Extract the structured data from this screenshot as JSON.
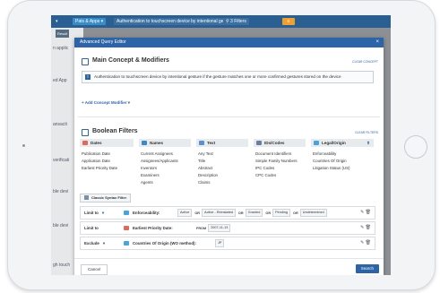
{
  "topbar": {
    "arrow": "▾",
    "pats": "Pats & Apps ▾",
    "auth_chip": "Authentication to touchscreen device by intentional gesture if...",
    "filters_chip": "⚲  3 Filters",
    "alert": "≡"
  },
  "background": {
    "tab": "Result",
    "labels": [
      "n applic",
      "ed App",
      "ansacti",
      "verificati",
      "ble devi",
      "ble devi",
      "gh touch"
    ]
  },
  "modal": {
    "title": "Advanced Query Editor",
    "close": "×",
    "main_concept": {
      "title": "Main Concept & Modifiers",
      "clear": "CLEAR CONCEPT",
      "icon_letter": "T",
      "text": "Authentication to touchscreen device by intentional gesture if the gesture matches one or more confirmed gestures stored on the device",
      "add_label": "+ Add Concept Modifier ▾"
    },
    "boolean": {
      "title": "Boolean Filters",
      "clear": "CLEAR FILTERS",
      "columns": [
        {
          "name": "Dates",
          "color": "#e06a5a",
          "items": [
            "Publication Date",
            "Application Date",
            "Earliest Priority Date"
          ]
        },
        {
          "name": "Names",
          "color": "#3a8cc6",
          "items": [
            "Current Assignees",
            "Assignees/Applicants",
            "Inventors",
            "Examiners",
            "Agents"
          ]
        },
        {
          "name": "Text",
          "color": "#5a8fd0",
          "items": [
            "Any Text",
            "Title",
            "Abstract",
            "Description",
            "Claims"
          ]
        },
        {
          "name": "IDs/Codes",
          "color": "#6a7fa0",
          "items": [
            "Document Identifiers",
            "Simple Family Numbers",
            "IPC Codes",
            "CPC Codes"
          ]
        },
        {
          "name": "Legal/Origin",
          "color": "#4aa3df",
          "items": [
            "Enforceability",
            "Countries Of Origin",
            "Litigation Status (US)"
          ]
        }
      ],
      "classic": "Classic Syntax Filter"
    },
    "filters": [
      {
        "mode": "Limit to",
        "name": "Enforceability:",
        "icon_color": "#4aa3df",
        "parts": [
          "Active",
          "OR",
          "Active - Reinstated",
          "OR",
          "Granted",
          "OR",
          "Pending",
          "OR",
          "Undetermined"
        ]
      },
      {
        "mode": "Limit to",
        "name": "Earliest Priority Date:",
        "icon_color": "#e06a5a",
        "parts": [
          "FROM",
          "2007-11-13"
        ]
      },
      {
        "mode": "Exclude",
        "name": "Countries Of Origin (WO method):",
        "icon_color": "#4aa3df",
        "parts": [
          "JP"
        ]
      }
    ],
    "actions_glyph": "✎ 🗑",
    "chevron": "▾",
    "cancel": "Cancel",
    "search": "Search"
  }
}
